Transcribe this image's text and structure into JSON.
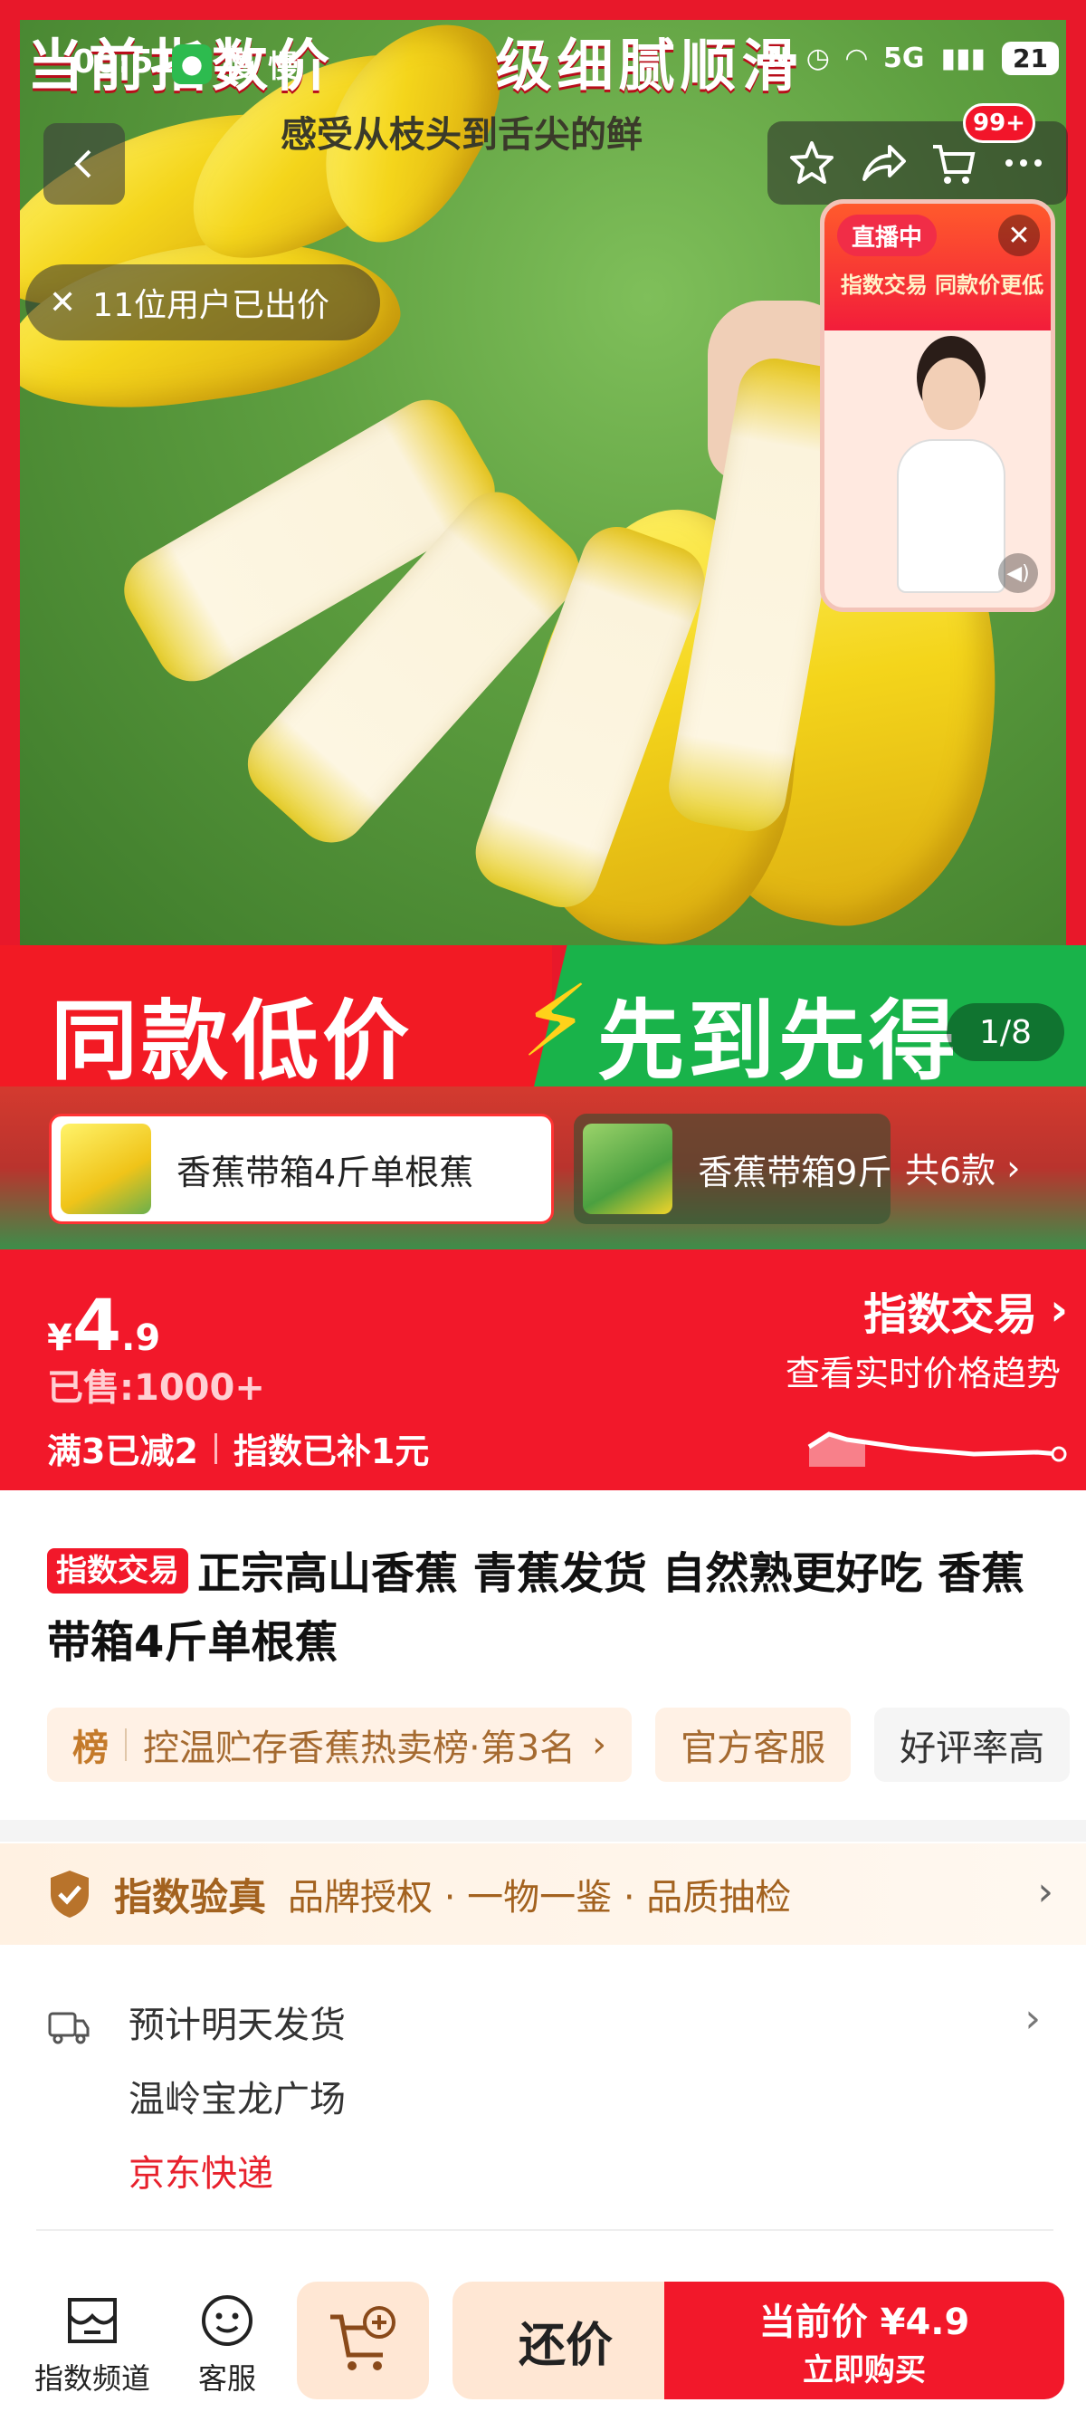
{
  "status_bar": {
    "time": "00:51",
    "apps": [
      "慢",
      "慢"
    ],
    "signal": "5G",
    "battery": "21"
  },
  "hero": {
    "headline": "当前指数价",
    "headline_right": "级细腻顺滑",
    "subtitle": "感受从枝头到舌尖的鲜",
    "bid_count_text": "11位用户已出价",
    "cart_badge": "99+",
    "promo_left": "同款低价",
    "promo_right": "先到先得",
    "image_counter": "1/8",
    "live": {
      "tag": "直播中",
      "banner": "指数交易 同款价更低"
    }
  },
  "sku": {
    "selected": "香蕉带箱4斤单根蕉",
    "other": "香蕉带箱9斤",
    "total": "共6款"
  },
  "price": {
    "currency": "¥",
    "integer": "4",
    "decimal": ".9",
    "sold": "已售:1000+",
    "promo1": "满3已减2",
    "promo2": "指数已补1元",
    "index_title": "指数交易",
    "index_sub": "查看实时价格趋势"
  },
  "product": {
    "tag": "指数交易",
    "title": "正宗高山香蕉 青蕉发货 自然熟更好吃 香蕉带箱4斤单根蕉",
    "chip_rank_label": "榜",
    "chip_rank_text": "控温贮存香蕉热卖榜·第3名",
    "chip_service": "官方客服",
    "chip_rating": "好评率高"
  },
  "verify": {
    "title": "指数验真",
    "desc": "品牌授权 · 一物一鉴 · 品质抽检"
  },
  "shipping": {
    "eta": "预计明天发货",
    "location": "温岭宝龙广场",
    "carrier": "京东快递"
  },
  "bottom_bar": {
    "channel": "指数频道",
    "service": "客服",
    "bargain": "还价",
    "buy_price": "当前价 ¥4.9",
    "buy_now": "立即购买"
  },
  "colors": {
    "brand_red": "#f2182a",
    "promo_green": "#19b34a",
    "verify_brown": "#a3621f",
    "carrier_red": "#e8212c"
  }
}
